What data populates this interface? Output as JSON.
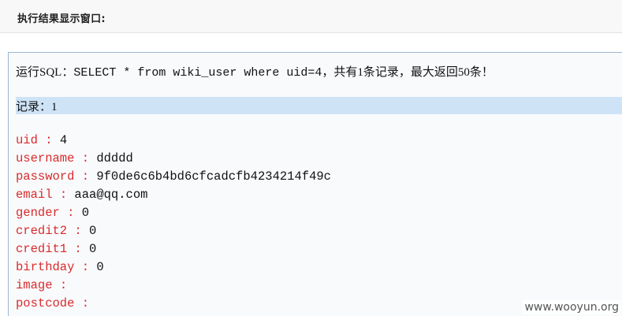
{
  "header": {
    "title": "执行结果显示窗口:"
  },
  "result": {
    "sql_prefix": "运行SQL：",
    "sql_query": "SELECT * from wiki_user where uid=4",
    "sql_suffix": "，共有1条记录，最大返回50条！",
    "record_label": "记录：1",
    "separator": " : ",
    "fields": [
      {
        "name": "uid",
        "value": "4"
      },
      {
        "name": "username",
        "value": "ddddd"
      },
      {
        "name": "password",
        "value": "9f0de6c6b4bd6cfcadcfb4234214f49c"
      },
      {
        "name": "email",
        "value": "aaa@qq.com"
      },
      {
        "name": "gender",
        "value": "0"
      },
      {
        "name": "credit2",
        "value": "0"
      },
      {
        "name": "credit1",
        "value": "0"
      },
      {
        "name": "birthday",
        "value": "0"
      },
      {
        "name": "image",
        "value": ""
      },
      {
        "name": "postcode",
        "value": ""
      }
    ]
  },
  "watermark": {
    "text": "www.wooyun.org"
  }
}
